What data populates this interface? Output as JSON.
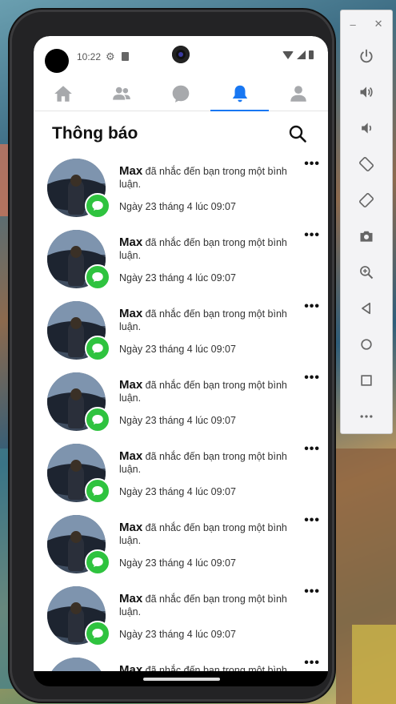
{
  "status_bar": {
    "time": "10:22"
  },
  "tabs": [
    {
      "icon": "home-icon",
      "active": false
    },
    {
      "icon": "friends-icon",
      "active": false
    },
    {
      "icon": "chat-icon",
      "active": false
    },
    {
      "icon": "bell-icon",
      "active": true
    },
    {
      "icon": "profile-icon",
      "active": false
    }
  ],
  "header": {
    "title": "Thông báo"
  },
  "notifications": [
    {
      "name": "Max",
      "message": "đã nhắc đến bạn trong một bình luận.",
      "time": "Ngày 23 tháng 4 lúc 09:07",
      "more": "•••"
    },
    {
      "name": "Max",
      "message": "đã nhắc đến bạn trong một bình luận.",
      "time": "Ngày 23 tháng 4 lúc 09:07",
      "more": "•••"
    },
    {
      "name": "Max",
      "message": "đã nhắc đến bạn trong một bình luận.",
      "time": "Ngày 23 tháng 4 lúc 09:07",
      "more": "•••"
    },
    {
      "name": "Max",
      "message": "đã nhắc đến bạn trong một bình luận.",
      "time": "Ngày 23 tháng 4 lúc 09:07",
      "more": "•••"
    },
    {
      "name": "Max",
      "message": "đã nhắc đến bạn trong một bình luận.",
      "time": "Ngày 23 tháng 4 lúc 09:07",
      "more": "•••"
    },
    {
      "name": "Max",
      "message": "đã nhắc đến bạn trong một bình luận.",
      "time": "Ngày 23 tháng 4 lúc 09:07",
      "more": "•••"
    },
    {
      "name": "Max",
      "message": "đã nhắc đến bạn trong một bình luận.",
      "time": "Ngày 23 tháng 4 lúc 09:07",
      "more": "•••"
    },
    {
      "name": "Max",
      "message": "đã nhắc đến bạn trong một bình luận.",
      "time": "",
      "more": "•••"
    }
  ],
  "emulator_panel": {
    "minimize": "–",
    "close": "✕",
    "buttons": [
      "power-icon",
      "volume-up-icon",
      "volume-down-icon",
      "rotate-left-icon",
      "rotate-right-icon",
      "camera-icon",
      "zoom-icon",
      "back-icon",
      "home-circle-icon",
      "overview-icon",
      "more-icon"
    ]
  },
  "colors": {
    "accent": "#1877f2",
    "badge": "#2fc33f",
    "tab_inactive": "#a7a9ac"
  }
}
